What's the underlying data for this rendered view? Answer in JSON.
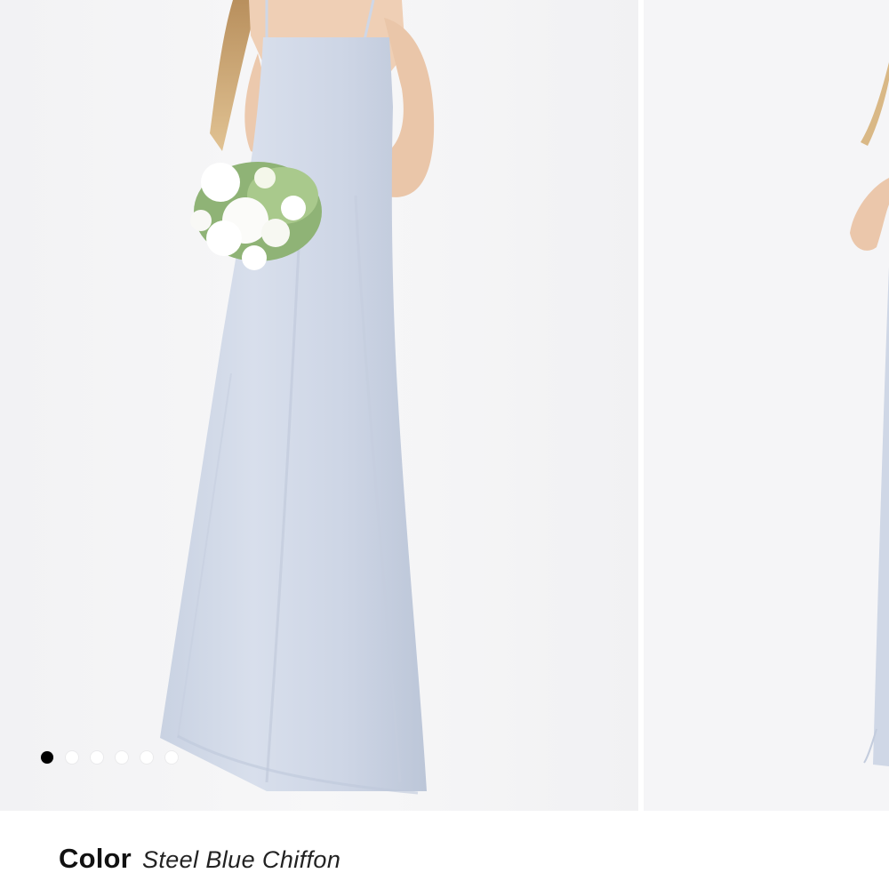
{
  "gallery": {
    "slide_count": 6,
    "active_index": 0,
    "slides": [
      {
        "alt": ""
      },
      {
        "alt": ""
      }
    ]
  },
  "color": {
    "label": "Color",
    "value": "Steel Blue Chiffon",
    "swatch_hex": "#d2dae8"
  },
  "colors": {
    "dress": "#d2dae8",
    "background": "#f4f4f6",
    "active_dot": "#000000",
    "inactive_dot": "#ffffff"
  }
}
